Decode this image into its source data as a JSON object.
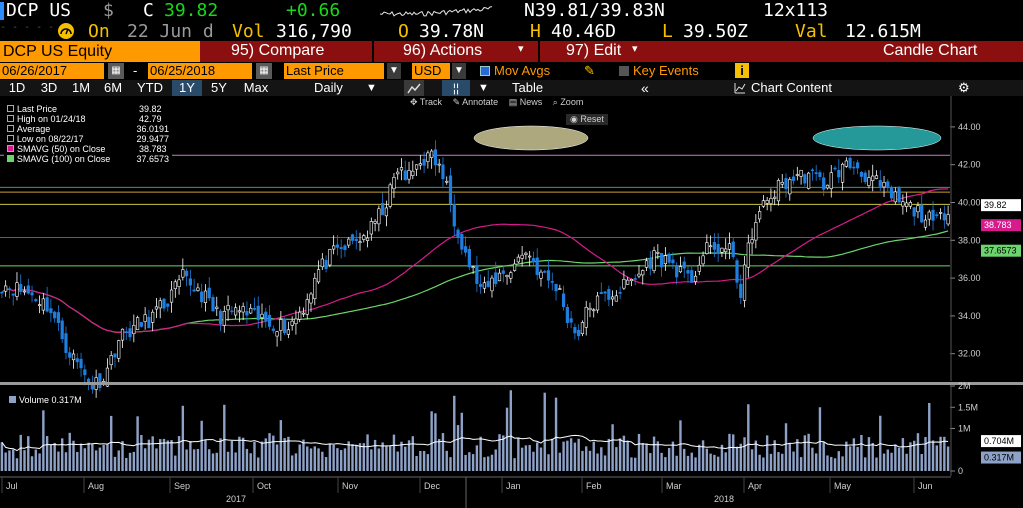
{
  "header": {
    "ticker": "DCP US",
    "currency_symbol": "$",
    "c_label": "C",
    "last": "39.82",
    "change": "+0.66",
    "bid_ask": "N39.81/39.83N",
    "size": "12x113",
    "on_label": "On",
    "date": "22 Jun d",
    "vol_label": "Vol",
    "volume": "316,790",
    "open_label": "O",
    "open": "39.78N",
    "high_label": "H",
    "high": "40.46D",
    "low_label": "L",
    "low": "39.50Z",
    "val_label": "Val",
    "value": "12.615M"
  },
  "title_bar": {
    "security": "DCP US Equity",
    "compare": "95) Compare",
    "actions": "96) Actions",
    "edit": "97) Edit",
    "chart_type": "Candle Chart"
  },
  "controls": {
    "start_date": "06/26/2017",
    "end_date": "06/25/2018",
    "dash": "-",
    "field": "Last Price",
    "currency": "USD",
    "mov_avgs": "Mov Avgs",
    "key_events": "Key Events",
    "info": "i"
  },
  "periods": [
    "1D",
    "3D",
    "1M",
    "6M",
    "YTD",
    "1Y",
    "5Y",
    "Max"
  ],
  "selected_period": "1Y",
  "frequency": "Daily",
  "table_label": "Table",
  "chart_content": "Chart Content",
  "tools": {
    "track": "Track",
    "annotate": "Annotate",
    "news": "News",
    "zoom": "Zoom",
    "reset": "Reset"
  },
  "legend": [
    {
      "label": "Last Price",
      "value": "39.82",
      "color": "#ffffff"
    },
    {
      "label": "High on 01/24/18",
      "value": "42.79",
      "color": "#ffffff"
    },
    {
      "label": "Average",
      "value": "36.0191",
      "color": "#ffffff"
    },
    {
      "label": "Low on 08/22/17",
      "value": "29.9477",
      "color": "#ffffff"
    },
    {
      "label": "SMAVG (50) on Close",
      "value": "38.783",
      "color": "#d61b8c"
    },
    {
      "label": "SMAVG (100) on Close",
      "value": "37.6573",
      "color": "#6cd46c"
    }
  ],
  "volume_legend": {
    "label": "Volume",
    "value": "0.317M"
  },
  "price_tags": {
    "last": "39.82",
    "sma50": "38.783",
    "sma100": "37.6573"
  },
  "volume_tags": {
    "avg": "0.704M",
    "last": "0.317M"
  },
  "price_ticks": [
    "44.00",
    "42.00",
    "40.00",
    "38.00",
    "36.00",
    "34.00",
    "32.00"
  ],
  "volume_ticks": [
    "2M",
    "1.5M",
    "1M",
    "0"
  ],
  "month_labels": [
    "Jul",
    "Aug",
    "Sep",
    "Oct",
    "Nov",
    "Dec",
    "Jan",
    "Feb",
    "Mar",
    "Apr",
    "May",
    "Jun"
  ],
  "year_labels": [
    "2017",
    "2018"
  ],
  "colors": {
    "up": "#ffffff",
    "down": "#1f7fe0",
    "sma50": "#d61b8c",
    "sma100": "#6cd46c",
    "accent": "#ff9900",
    "bar": "#8c0f0f"
  }
}
